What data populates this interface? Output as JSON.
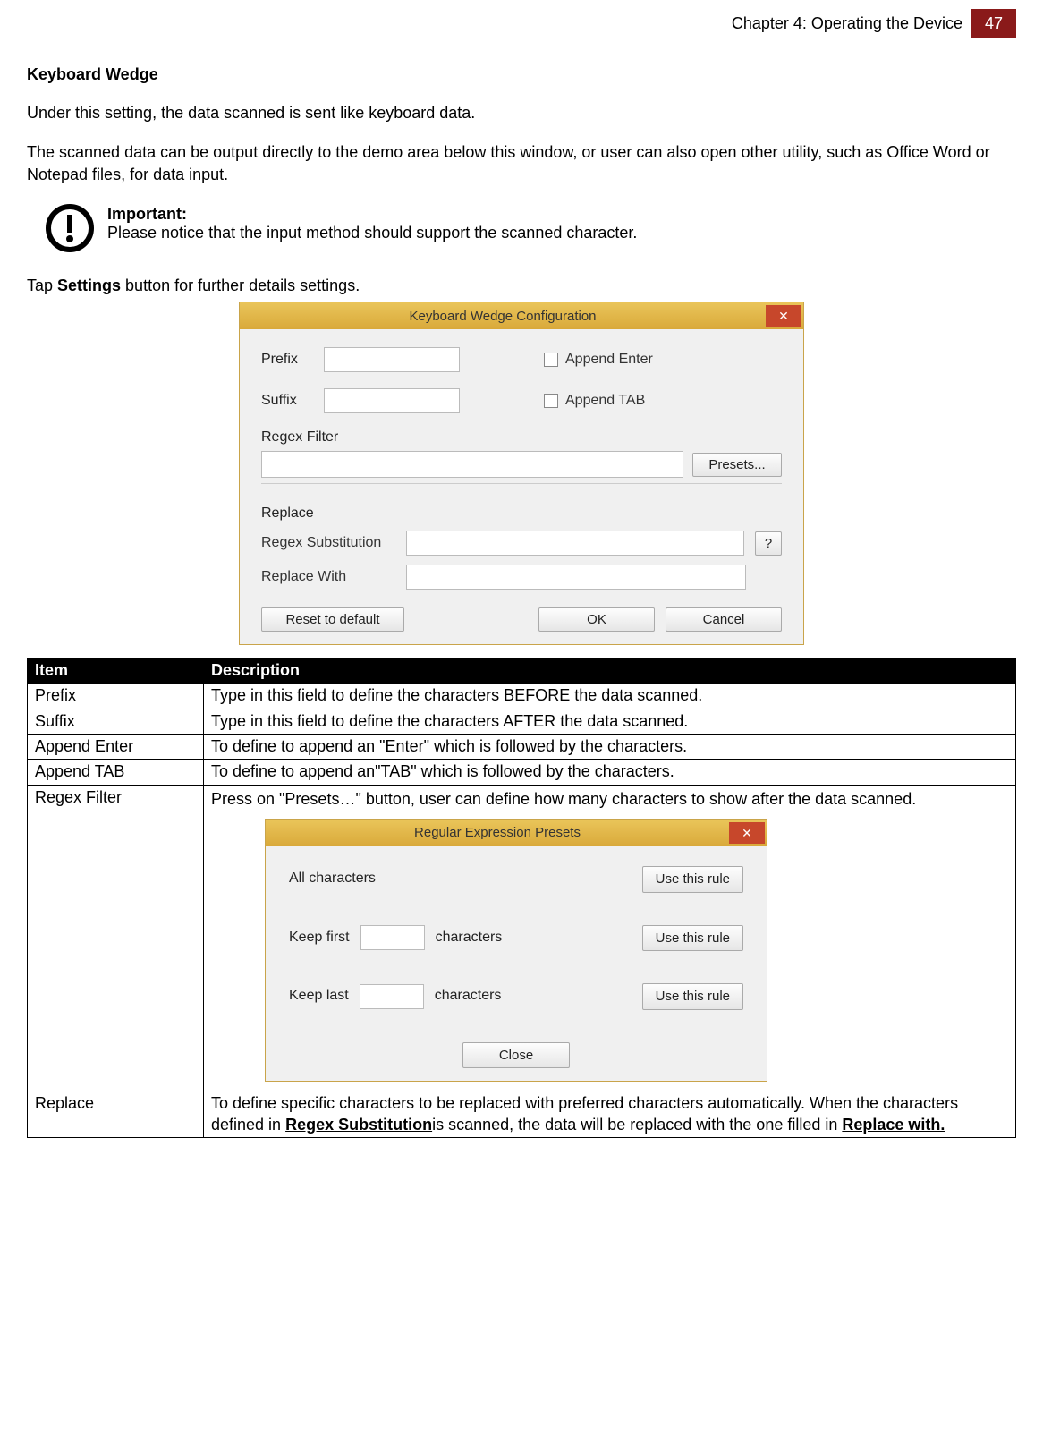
{
  "header": {
    "chapter": "Chapter 4: Operating the Device",
    "page": "47"
  },
  "section": {
    "title": "Keyboard Wedge"
  },
  "para1": "Under this setting, the data scanned is sent like keyboard data.",
  "para2": "The scanned data can be output directly to the demo area below this window, or user can also open other utility, such as Office Word or Notepad files, for data input.",
  "important": {
    "label": "Important:",
    "text": "Please notice that the input method should support the scanned character."
  },
  "tapline": {
    "pre": "Tap ",
    "bold": "Settings",
    "post": " button for further details settings."
  },
  "dialog1": {
    "title": "Keyboard Wedge Configuration",
    "prefix_label": "Prefix",
    "suffix_label": "Suffix",
    "append_enter": "Append Enter",
    "append_tab": "Append TAB",
    "regex_filter": "Regex Filter",
    "presets_btn": "Presets...",
    "replace_label": "Replace",
    "regex_sub": "Regex Substitution",
    "replace_with": "Replace With",
    "q": "?",
    "reset": "Reset to default",
    "ok": "OK",
    "cancel": "Cancel"
  },
  "table": {
    "h_item": "Item",
    "h_desc": "Description",
    "rows": {
      "prefix": {
        "item": "Prefix",
        "desc": "Type in this field to define the characters BEFORE the data scanned."
      },
      "suffix": {
        "item": "Suffix",
        "desc": "Type in this field to define the characters AFTER the data scanned."
      },
      "append_enter": {
        "item": "Append Enter",
        "desc": "To define to append an \"Enter\" which is followed by the characters."
      },
      "append_tab": {
        "item": "Append TAB",
        "desc": "To define to append an\"TAB\" which is followed by the characters."
      },
      "regex_filter": {
        "item": "Regex Filter",
        "desc": "Press on \"Presets…\" button, user can define how many characters to show after the data scanned."
      },
      "replace": {
        "item": "Replace",
        "desc_pre": "To define specific characters to be replaced with preferred characters automatically. When the characters defined in ",
        "desc_u1": "Regex Substitution",
        "desc_mid": "is scanned, the data will be replaced with the one filled in ",
        "desc_u2": "Replace with."
      }
    }
  },
  "dialog2": {
    "title": "Regular Expression Presets",
    "all": "All characters",
    "keep_first": "Keep first",
    "keep_last": "Keep last",
    "characters": "characters",
    "use_rule": "Use this rule",
    "close": "Close"
  }
}
